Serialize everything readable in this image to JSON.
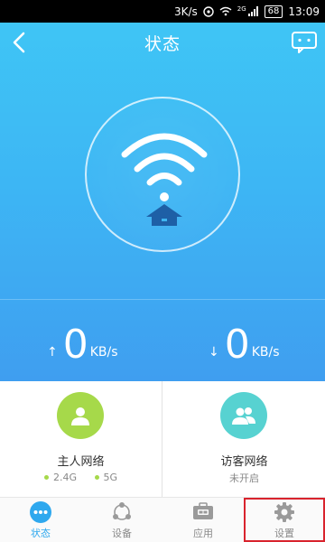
{
  "status_bar": {
    "speed": "3K/s",
    "network_type": "2G",
    "battery": "68",
    "time": "13:09"
  },
  "header": {
    "title": "状态",
    "icons": {
      "back": "back-arrow-icon",
      "message": "chat-bubble-icon"
    }
  },
  "hero": {
    "upload": {
      "value": "0",
      "unit": "KB/s",
      "arrow": "↑"
    },
    "download": {
      "value": "0",
      "unit": "KB/s",
      "arrow": "↓"
    },
    "colors": {
      "top": "#3fc5f5",
      "bottom": "#3f9ef0"
    }
  },
  "cards": {
    "host": {
      "title": "主人网络",
      "bands": [
        "2.4G",
        "5G"
      ],
      "color": "#a6d94a"
    },
    "guest": {
      "title": "访客网络",
      "status": "未开启",
      "color": "#57d2d1"
    }
  },
  "tabs": [
    {
      "label": "状态",
      "icon": "dots-icon",
      "active": true
    },
    {
      "label": "设备",
      "icon": "devices-icon",
      "active": false
    },
    {
      "label": "应用",
      "icon": "tp-app-icon",
      "active": false
    },
    {
      "label": "设置",
      "icon": "gear-icon",
      "active": false
    }
  ],
  "accent": "#2ea8ee",
  "highlight": "#d9232d"
}
